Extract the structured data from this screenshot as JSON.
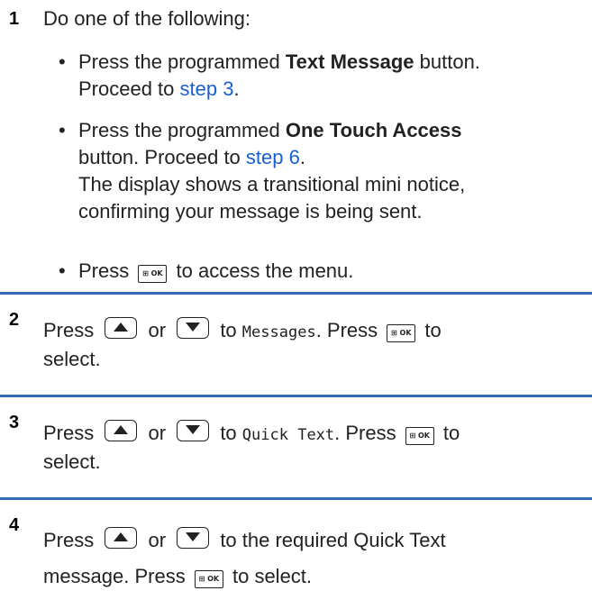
{
  "step1": {
    "number": "1",
    "intro": "Do one of the following:",
    "b1_pre": "Press the programmed ",
    "b1_bold": "Text Message",
    "b1_post": " button.",
    "b1_proceed": "Proceed to ",
    "b1_link": "step 3",
    "b2_pre": "Press the programmed ",
    "b2_bold": "One Touch Access",
    "b2_post": "button. Proceed to ",
    "b2_link": "step 6",
    "b2_note1": "The display shows a transitional mini notice,",
    "b2_note2": "confirming your message is being sent.",
    "b3_pre": "Press",
    "b3_post": "to access the menu."
  },
  "step2": {
    "number": "2",
    "press": "Press",
    "or": "or",
    "to": "to",
    "item": "Messages",
    "press2": ". Press",
    "to2": "to",
    "select": "select."
  },
  "step3": {
    "number": "3",
    "press": "Press",
    "or": "or",
    "to": "to",
    "item": "Quick Text",
    "press2": ". Press",
    "to2": "to",
    "select": "select."
  },
  "step4": {
    "number": "4",
    "press": "Press",
    "or": "or",
    "line1_end": "to the required Quick Text",
    "line2_pre": "message. Press",
    "line2_post": "to select."
  },
  "icons": {
    "ok_button": "menu-ok-icon",
    "up": "up-arrow-icon",
    "down": "down-arrow-icon"
  },
  "ok_label": "⊞ OK",
  "colors": {
    "link": "#1a5fd1",
    "divider": "#2f6cb5"
  }
}
